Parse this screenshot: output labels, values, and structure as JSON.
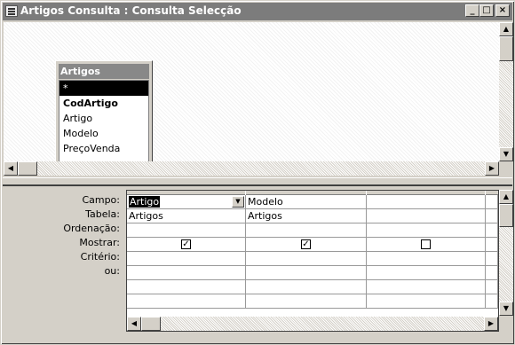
{
  "window": {
    "title": "Artigos Consulta : Consulta Selecção",
    "minimize": "_",
    "restore": "□",
    "close": "×"
  },
  "field_list": {
    "table_name": "Artigos",
    "fields": [
      "*",
      "CodArtigo",
      "Artigo",
      "Modelo",
      "PreçoVenda"
    ],
    "selected_index": 0,
    "bold_index": 1
  },
  "grid": {
    "row_labels": [
      "Campo:",
      "Tabela:",
      "Ordenação:",
      "Mostrar:",
      "Critério:",
      "ou:"
    ],
    "columns": [
      {
        "campo": "Artigo",
        "tabela": "Artigos",
        "ordenacao": "",
        "mostrar": true,
        "criterio": "",
        "ou": ""
      },
      {
        "campo": "Modelo",
        "tabela": "Artigos",
        "ordenacao": "",
        "mostrar": true,
        "criterio": "",
        "ou": ""
      },
      {
        "campo": "",
        "tabela": "",
        "ordenacao": "",
        "mostrar": false,
        "criterio": "",
        "ou": ""
      }
    ]
  },
  "icons": {
    "arrow_up": "▲",
    "arrow_down": "▼",
    "arrow_left": "◀",
    "arrow_right": "▶",
    "check": "✓"
  }
}
